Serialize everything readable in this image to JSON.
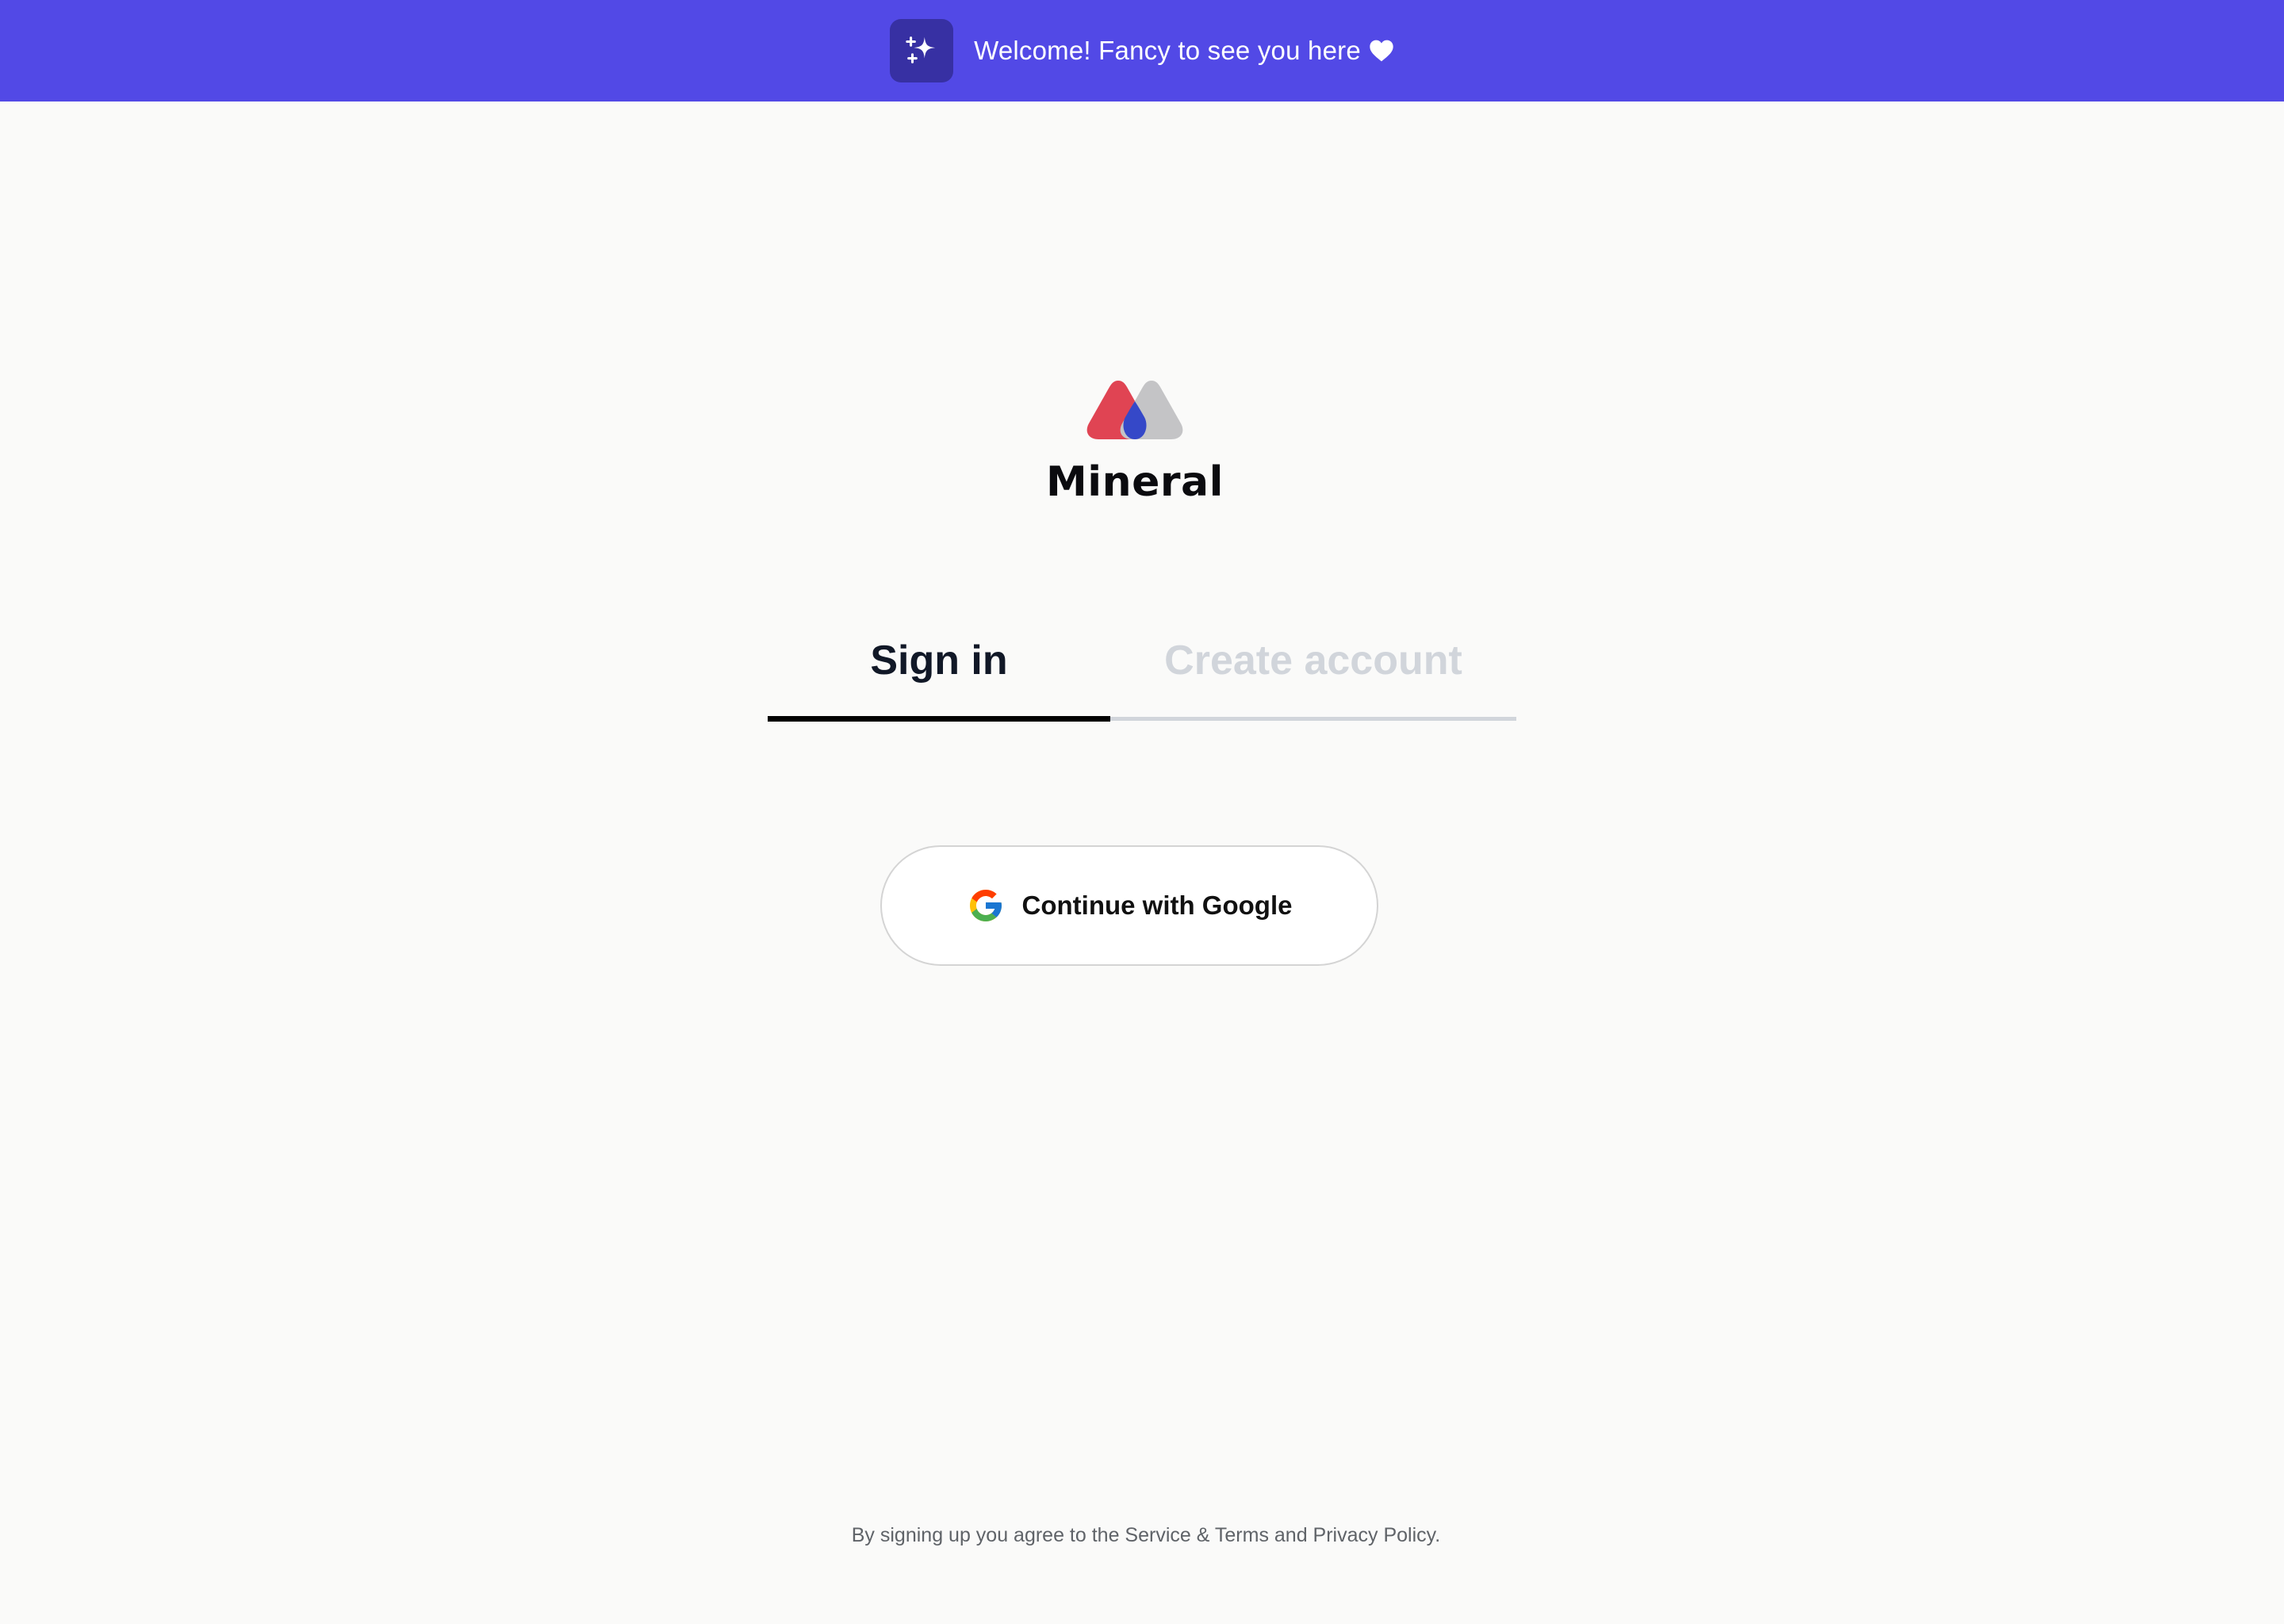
{
  "banner": {
    "message": "Welcome! Fancy to see you here",
    "icon": "sparkles-icon",
    "trailing_icon": "heart-icon",
    "background": "#5249e6",
    "icon_background": "#3730a3"
  },
  "brand": {
    "name": "Mineral",
    "logo_colors": {
      "left": "#e04453",
      "right": "#c4c4c6",
      "center": "#3548c8"
    }
  },
  "tabs": {
    "items": [
      {
        "label": "Sign in",
        "active": true
      },
      {
        "label": "Create account",
        "active": false
      }
    ]
  },
  "auth": {
    "google_label": "Continue with Google",
    "google_icon": "google-icon"
  },
  "footer": {
    "text": "By signing up you agree to the Service & Terms and Privacy Policy."
  }
}
